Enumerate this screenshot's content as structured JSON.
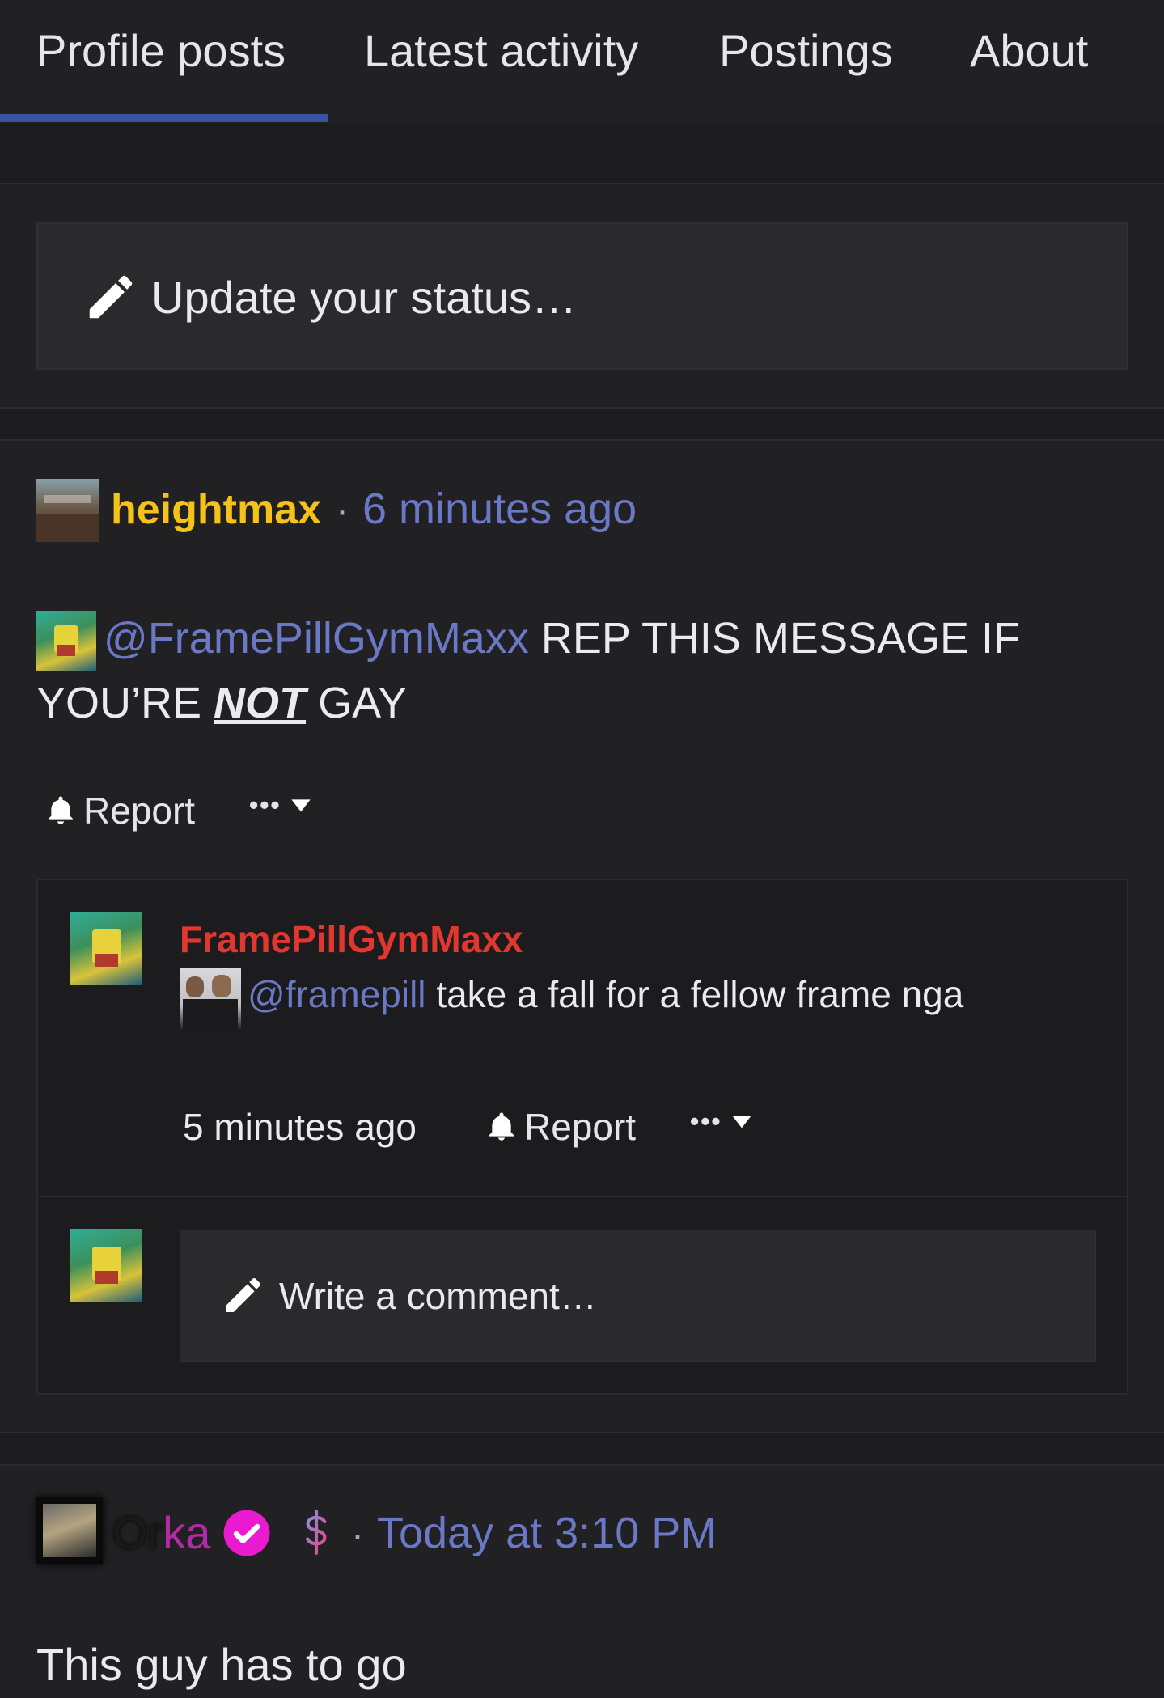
{
  "tabs": [
    {
      "label": "Profile posts",
      "active": true
    },
    {
      "label": "Latest activity",
      "active": false
    },
    {
      "label": "Postings",
      "active": false
    },
    {
      "label": "About",
      "active": false
    }
  ],
  "status": {
    "placeholder": "Update your status…"
  },
  "post1": {
    "author": "heightmax",
    "author_color": "#f4c21b",
    "separator": "·",
    "time": "6 minutes ago",
    "mention": "@FramePillGymMaxx",
    "text_a": "REP THIS MESSAGE IF",
    "text_b": "YOU’RE",
    "text_emph": "NOT",
    "text_c": "GAY",
    "report": "Report",
    "more": "•••"
  },
  "comment1": {
    "author": "FramePillGymMaxx",
    "author_color": "#e0372e",
    "mention": "@framepill",
    "text": "take a fall for a fellow frame nga",
    "time": "5 minutes ago",
    "report": "Report",
    "more": "•••"
  },
  "comment_input": {
    "placeholder": "Write a comment…"
  },
  "post2": {
    "author_a": "Or",
    "author_b": "ka",
    "separator": "·",
    "time": "Today at 3:10 PM",
    "text": "This guy has to go",
    "verified_icon": "verified-check-icon",
    "dollar_icon": "dollar-icon"
  },
  "colors": {
    "accent": "#3953a0",
    "link": "#6a78c6",
    "background": "#212123",
    "verified": "#e91ad0"
  }
}
